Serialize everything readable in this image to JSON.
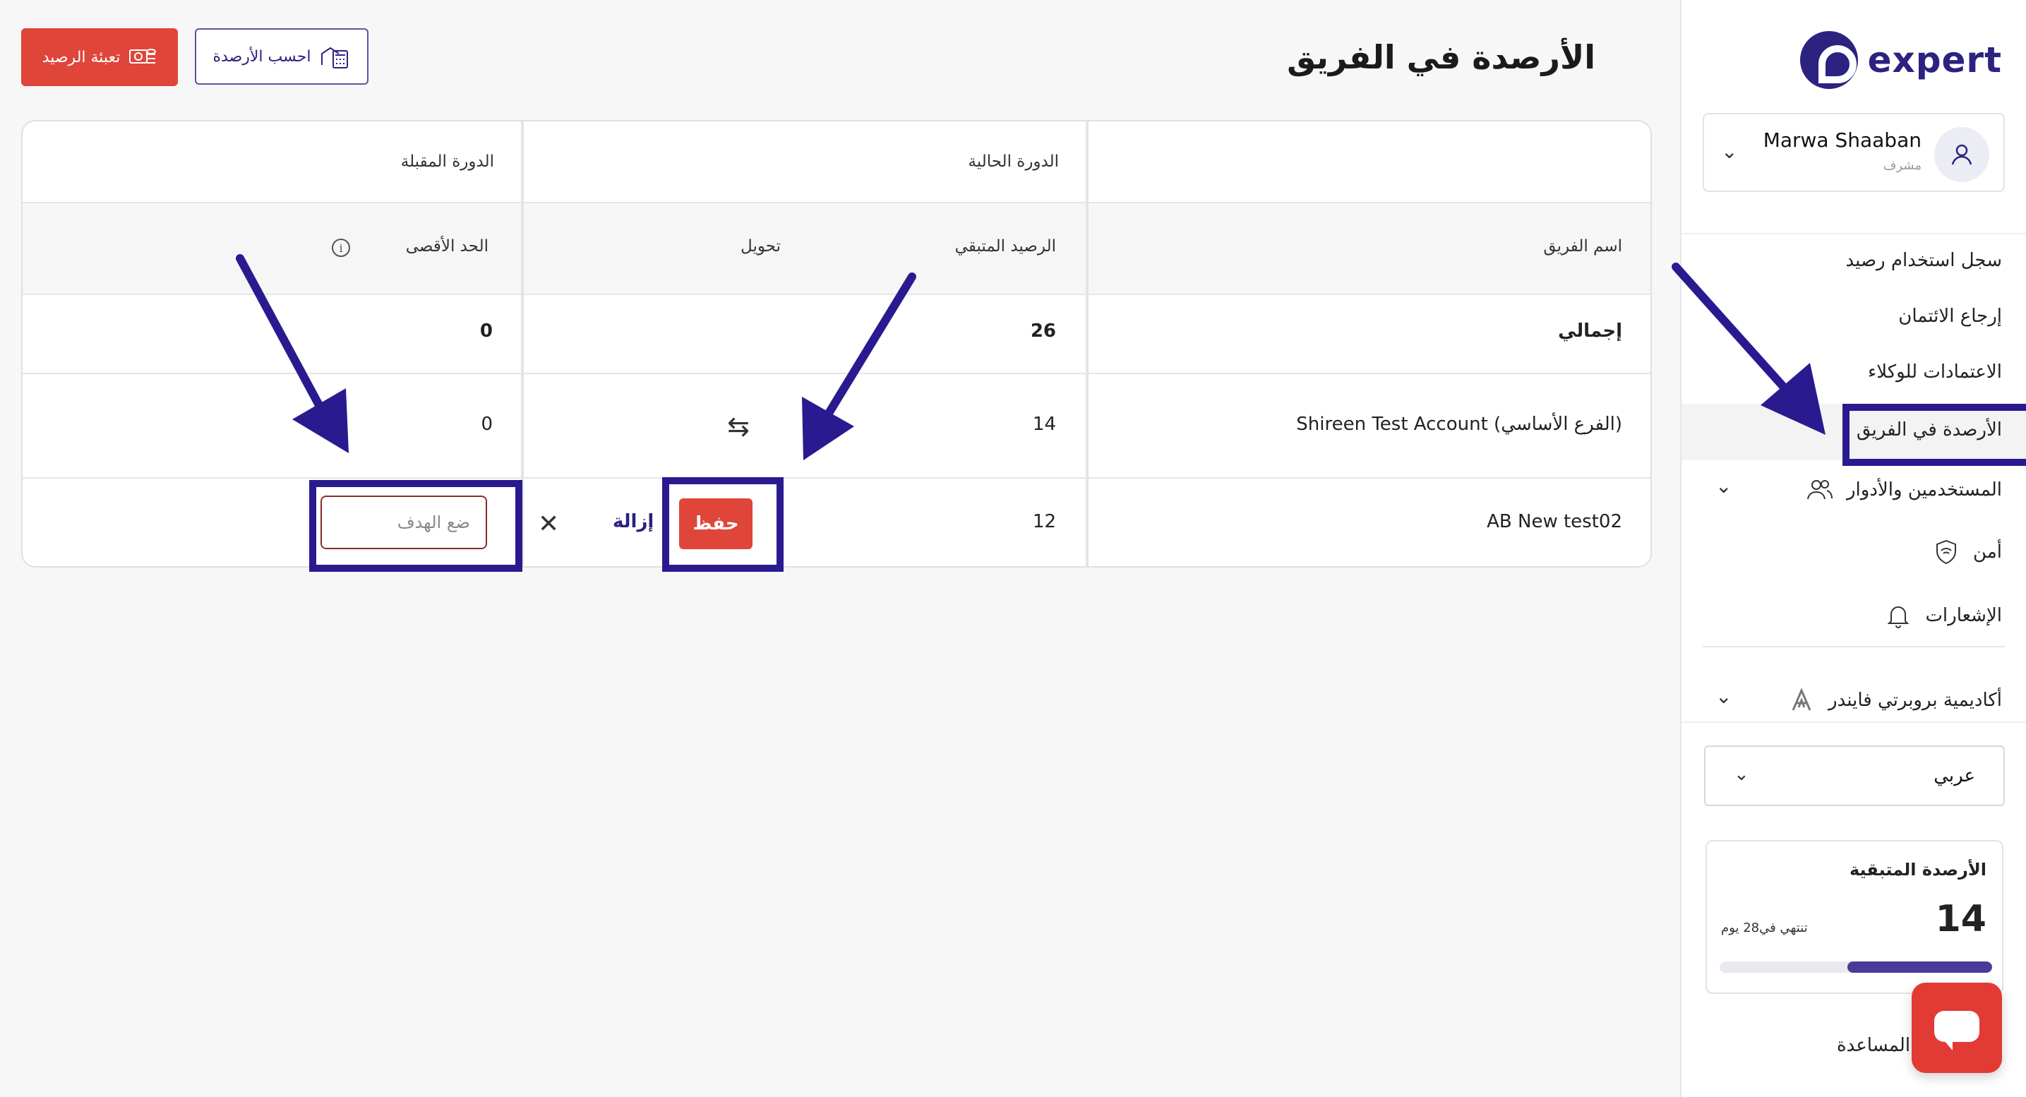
{
  "app": {
    "brand": "expert"
  },
  "user": {
    "name": "Marwa Shaaban",
    "role": "مشرف"
  },
  "sidebar": {
    "items": [
      {
        "label": "سجل استخدام رصيد"
      },
      {
        "label": "إرجاع الائتمان"
      },
      {
        "label": "الاعتمادات للوكلاء"
      },
      {
        "label": "الأرصدة في الفريق"
      },
      {
        "label": "المستخدمين والأدوار"
      },
      {
        "label": "أمن"
      },
      {
        "label": "الإشعارات"
      },
      {
        "label": "أكاديمية بروبرتي فايندر"
      }
    ],
    "language": "عربي",
    "credits": {
      "title": "الأرصدة المتبقية",
      "value": "14",
      "expires": "تنتهي في28 يوم",
      "progress_fraction": 0.53
    },
    "help": "ز المساعدة"
  },
  "header": {
    "title": "الأرصدة في الفريق",
    "calc_button": "احسب الأرصدة",
    "topup_button": "تعبئة الرصيد"
  },
  "table": {
    "group_current": "الدورة الحالية",
    "group_next": "الدورة المقبلة",
    "col_team": "اسم الفريق",
    "col_remaining": "الرصيد المتبقي",
    "col_transfer": "تحويل",
    "col_max": "الحد الأقصى",
    "info_symbol": "i",
    "rows": [
      {
        "team": "إجمالي",
        "remaining": "26",
        "max": "0"
      },
      {
        "team": "Shireen Test Account (الفرع الأساسي)",
        "remaining": "14",
        "max": "0"
      },
      {
        "team": "AB New test02",
        "remaining": "12"
      }
    ],
    "edit": {
      "save": "حفظ",
      "remove": "إزالة",
      "close": "✕",
      "placeholder": "ضع الهدف"
    }
  },
  "colors": {
    "accent_red": "#e0453a",
    "brand_purple": "#2c2280",
    "annotation": "#2a1a8f"
  }
}
